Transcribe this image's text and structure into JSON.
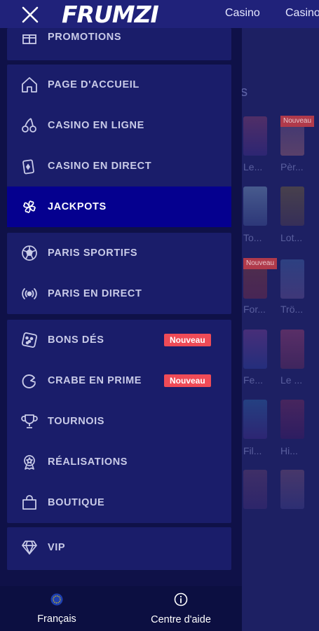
{
  "header": {
    "logo_text": "FRUMZI",
    "nav": [
      "Casino",
      "Casino"
    ]
  },
  "background": {
    "section_title_fragment": "es",
    "tiles": [
      {
        "label": "Le..."
      },
      {
        "label": "Pèr..."
      },
      {
        "label": "To..."
      },
      {
        "label": "Lot..."
      },
      {
        "label": "For..."
      },
      {
        "label": "Trö..."
      },
      {
        "label": "Fe..."
      },
      {
        "label": "Le ..."
      },
      {
        "label": "Fil..."
      },
      {
        "label": "Hi..."
      }
    ],
    "badges": [
      "Nouveau",
      "Nouveau"
    ]
  },
  "menu": {
    "partial": {
      "label": "PROMOTIONS",
      "icon": "gift-icon"
    },
    "main": [
      {
        "label": "PAGE D'ACCUEIL",
        "icon": "home-icon"
      },
      {
        "label": "CASINO EN LIGNE",
        "icon": "cherry-icon"
      },
      {
        "label": "CASINO EN DIRECT",
        "icon": "cards-icon"
      },
      {
        "label": "JACKPOTS",
        "icon": "clover-icon",
        "active": true
      }
    ],
    "sports": [
      {
        "label": "PARIS SPORTIFS",
        "icon": "soccer-ball-icon"
      },
      {
        "label": "PARIS EN DIRECT",
        "icon": "broadcast-icon"
      }
    ],
    "extras": [
      {
        "label": "BONS DÉS",
        "icon": "dice-icon",
        "badge": "Nouveau"
      },
      {
        "label": "CRABE EN PRIME",
        "icon": "crab-icon",
        "badge": "Nouveau"
      },
      {
        "label": "TOURNOIS",
        "icon": "trophy-icon"
      },
      {
        "label": "RÉALISATIONS",
        "icon": "medal-icon"
      },
      {
        "label": "BOUTIQUE",
        "icon": "shopping-bag-icon"
      }
    ],
    "vip": [
      {
        "label": "VIP",
        "icon": "diamond-icon"
      }
    ]
  },
  "bottom_bar": {
    "language": "Français",
    "help": "Centre d'aide"
  },
  "colors": {
    "accent_active": "#05008f",
    "badge": "#ef4b57",
    "logo_blue": "#4d8df7",
    "drawer_bg": "#0f1148",
    "group_bg": "#1a1d6a"
  }
}
